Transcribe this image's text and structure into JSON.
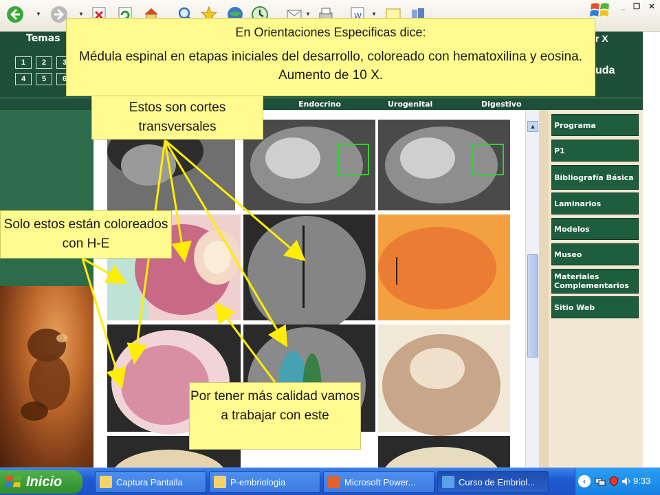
{
  "browser": {
    "toolbar_icons": [
      "back-icon",
      "forward-icon",
      "stop-icon",
      "refresh-icon",
      "home-icon",
      "search-icon",
      "favorites-icon",
      "media-icon",
      "history-icon",
      "mail-icon",
      "print-icon",
      "edit-icon",
      "discuss-icon",
      "messenger-icon"
    ]
  },
  "site": {
    "temas_label": "Temas",
    "numbers": [
      "1",
      "2",
      "3",
      "4",
      "5",
      "6"
    ],
    "right_header_letter": "r X",
    "right_header_word": "uda",
    "nav": [
      "Endocrino",
      "Urogenital",
      "Digestivo"
    ],
    "menu": [
      "Programa",
      "P1",
      "Bibliografía Básica",
      "Laminarios",
      "Modelos",
      "Museo",
      "Materiales Complementarios",
      "Sitio Web"
    ]
  },
  "callouts": {
    "top_line1": "En Orientaciones Especificas dice:",
    "top_line2": "Médula espinal en etapas iniciales del desarrollo, coloreado con hematoxilina y eosina. Aumento de 10 X.",
    "cortes": "Estos son cortes transversales",
    "he": "Solo estos están coloreados con H-E",
    "calidad": "Por tener más calidad vamos a trabajar con este"
  },
  "taskbar": {
    "start_label": "Inicio",
    "tasks": [
      "Captura Pantalla",
      "P-embriologia",
      "Microsoft Power...",
      "Curso de Embriol..."
    ],
    "clock": "9:33"
  },
  "colors": {
    "callout_bg": "#fffb8f",
    "arrow": "#ffee00",
    "site_green": "#1e4f38",
    "taskbar_blue": "#1f5bd4"
  }
}
